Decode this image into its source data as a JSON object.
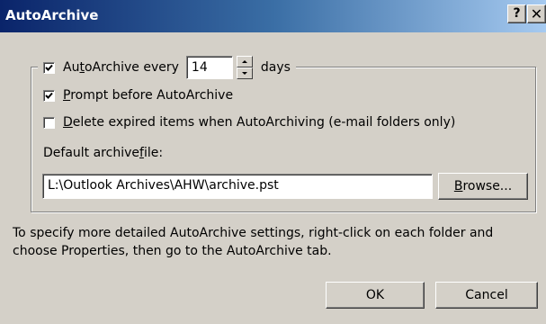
{
  "window": {
    "title": "AutoArchive",
    "help_glyph": "?",
    "close_glyph": "✕"
  },
  "autoarchive": {
    "checked": true,
    "label_prefix": "Au",
    "label_mnemonic": "t",
    "label_suffix": "oArchive every",
    "days_value": "14",
    "days_label": "days"
  },
  "prompt": {
    "checked": true,
    "mnemonic": "P",
    "label_rest": "rompt before AutoArchive"
  },
  "delete_expired": {
    "checked": false,
    "mnemonic": "D",
    "label_rest": "elete expired items when AutoArchiving (e-mail folders only)"
  },
  "archive_file": {
    "label_prefix": "Default archive ",
    "label_mnemonic": "f",
    "label_suffix": "ile:",
    "value": "L:\\Outlook Archives\\AHW\\archive.pst",
    "browse_mnemonic": "B",
    "browse_rest": "rowse..."
  },
  "info_text": "To specify more detailed AutoArchive settings, right-click on each folder and choose Properties, then go to the AutoArchive tab.",
  "buttons": {
    "ok": "OK",
    "cancel": "Cancel"
  }
}
